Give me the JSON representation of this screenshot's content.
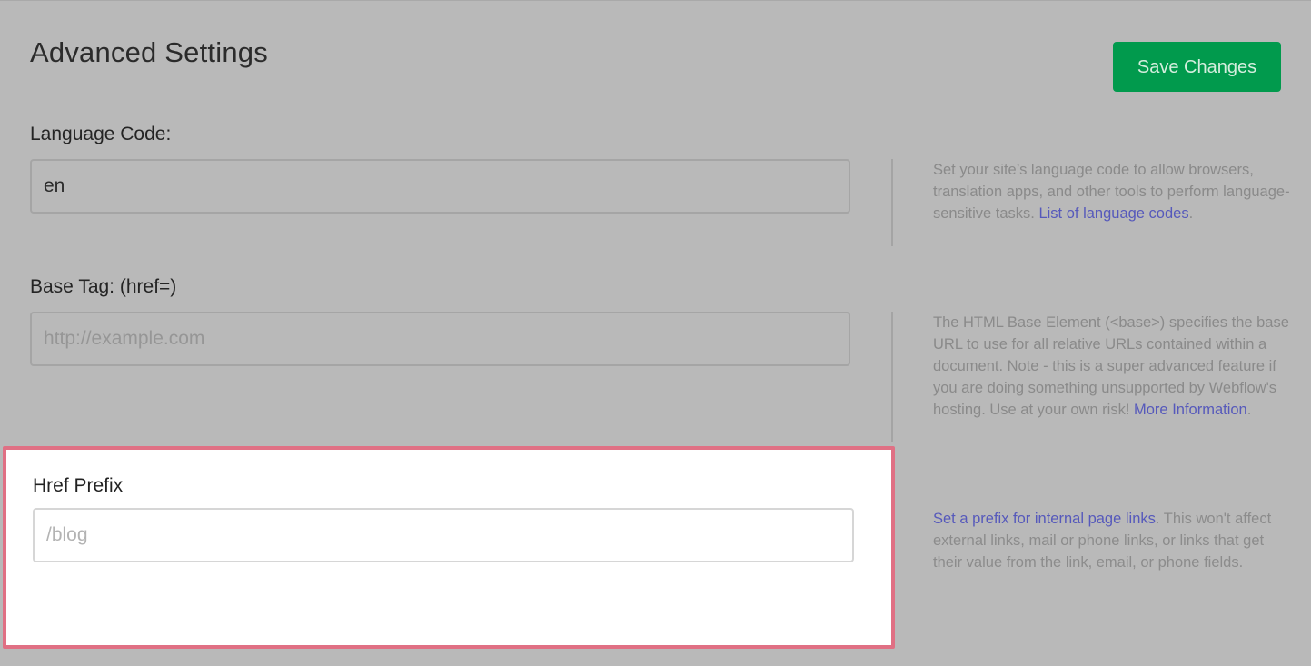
{
  "header": {
    "title": "Advanced Settings",
    "save_label": "Save Changes"
  },
  "colors": {
    "save_button": "#019a4d",
    "link": "#5659bb",
    "highlight_border": "#e07084"
  },
  "language_code": {
    "label": "Language Code:",
    "value": "en",
    "help_text": "Set your site’s language code to allow browsers, translation apps, and other tools to perform language-sensitive tasks. ",
    "help_link": "List of language codes",
    "help_suffix": "."
  },
  "base_tag": {
    "label": "Base Tag: (href=)",
    "placeholder": "http://example.com",
    "help_text": "The HTML Base Element (<base>) specifies the base URL to use for all relative URLs contained within a document. Note - this is a super advanced feature if you are doing something unsupported by Webflow's hosting. Use at your own risk! ",
    "help_link": "More Information",
    "help_suffix": "."
  },
  "href_prefix": {
    "label": "Href Prefix",
    "placeholder": "/blog",
    "help_link": "Set a prefix for internal page links",
    "help_text": ". This won't affect external links, mail or phone links, or links that get their value from the link, email, or phone fields."
  }
}
